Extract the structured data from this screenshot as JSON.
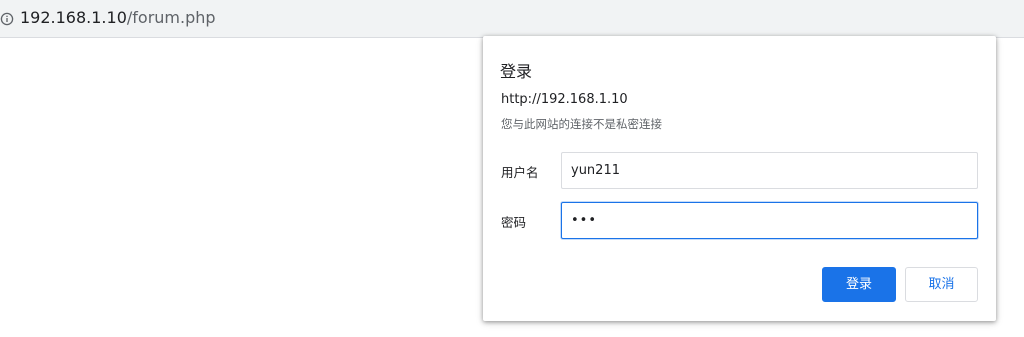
{
  "address_bar": {
    "icon": "info-icon",
    "url_host": "192.168.1.10",
    "url_path": "/forum.php"
  },
  "dialog": {
    "title": "登录",
    "origin": "http://192.168.1.10",
    "warning": "您与此网站的连接不是私密连接",
    "username_label": "用户名",
    "username_value": "yun211",
    "password_label": "密码",
    "password_value": "•••",
    "login_button": "登录",
    "cancel_button": "取消"
  },
  "colors": {
    "accent": "#1a73e8",
    "toolbar_bg": "#f1f3f4",
    "border": "#dadce0"
  }
}
